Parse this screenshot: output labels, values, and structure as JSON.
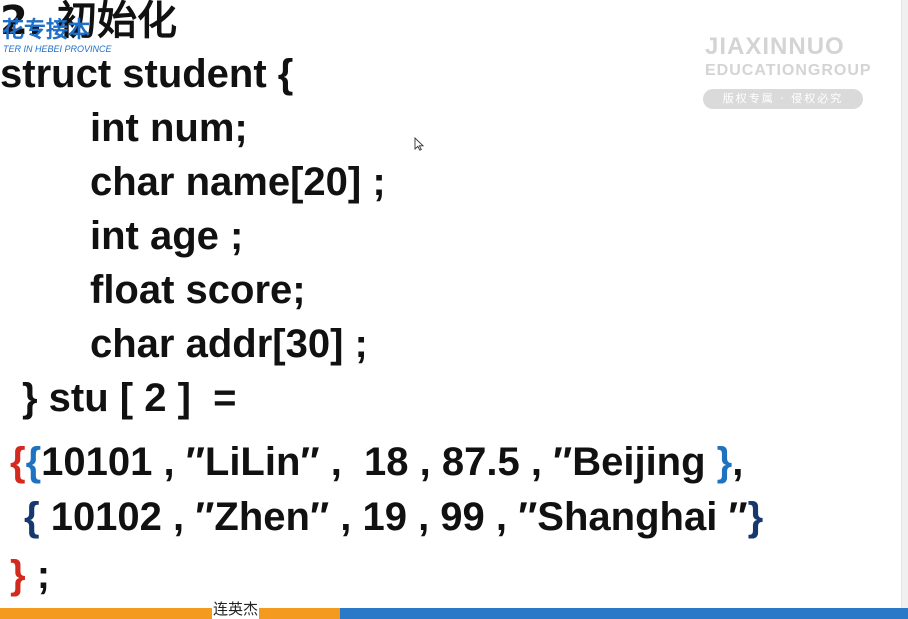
{
  "slide": {
    "title": "2. 初始化",
    "logo_cn": "花专接本",
    "logo_en": "TER IN HEBEI PROVINCE"
  },
  "watermark": {
    "line1": "JIAXINNUO",
    "line2": "EDUCATIONGROUP",
    "badge": "版权专属 · 侵权必究"
  },
  "code": {
    "line1": "struct student {",
    "line2": "int num;",
    "line3": "char name[20] ;",
    "line4": "int age ;",
    "line5": "float score;",
    "line6": "char addr[30] ;",
    "line7": "} stu [ 2 ]  =",
    "row1": {
      "open_outer": "{",
      "open_inner": "{",
      "text": "10101 , ″LiLin″ ,  18 , 87.5 , ″Beijing ",
      "close": "}",
      "comma": ","
    },
    "row2": {
      "open": "{",
      "text": " 10102 , ″Zhen″ , 19 , 99 , ″Shanghai ″",
      "close": "}"
    },
    "end": {
      "close": "}",
      "semicolon": " ;"
    }
  },
  "caption": "连英杰",
  "colors": {
    "brace_red": "#d22a1e",
    "brace_blue": "#1e72c0",
    "brace_navy": "#17386e",
    "bar_orange": "#f39a1f",
    "bar_blue": "#2a78c8",
    "logo_blue": "#1e6fc7"
  }
}
